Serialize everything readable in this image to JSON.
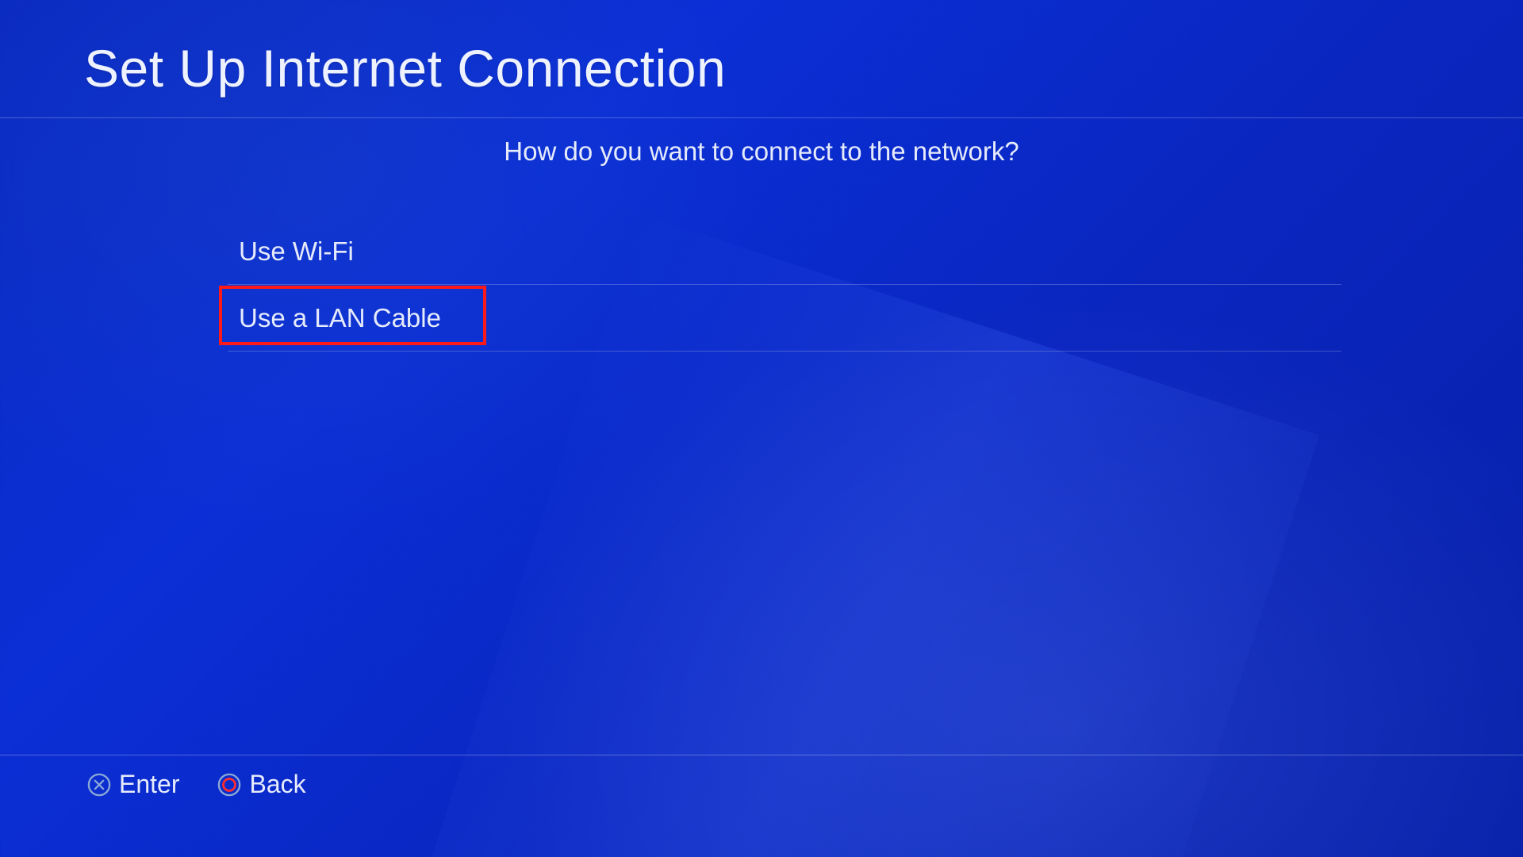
{
  "header": {
    "title": "Set Up Internet Connection"
  },
  "prompt": "How do you want to connect to the network?",
  "options": [
    {
      "label": "Use Wi-Fi"
    },
    {
      "label": "Use a LAN Cable"
    }
  ],
  "footer": {
    "enter": {
      "label": "Enter",
      "icon": "x-button-icon"
    },
    "back": {
      "label": "Back",
      "icon": "o-button-icon"
    }
  },
  "colors": {
    "highlight": "#ff1a1a",
    "x_button": "#8aa8d6",
    "o_button": "#ff2e2e",
    "text": "#e8ecf7"
  }
}
